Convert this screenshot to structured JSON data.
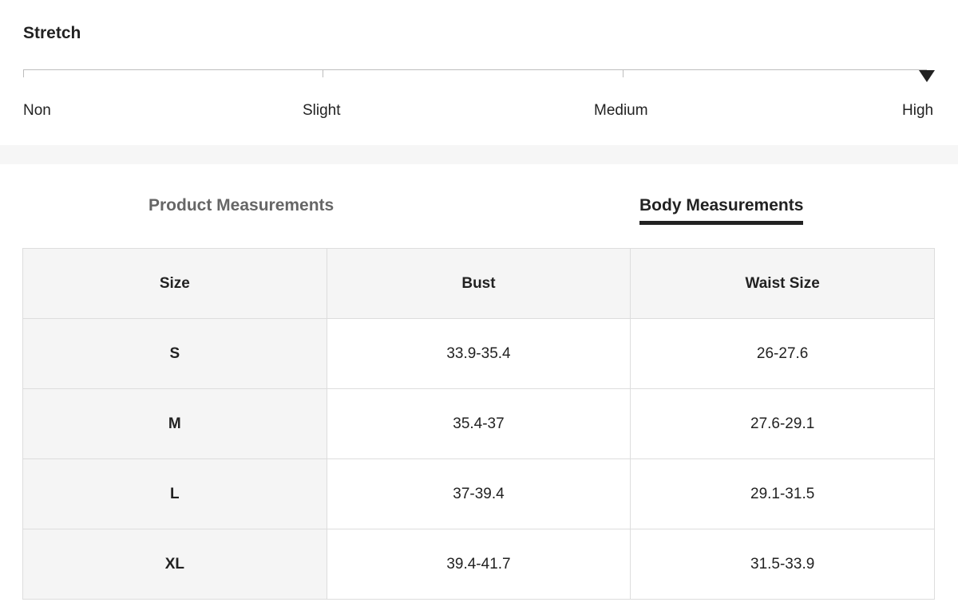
{
  "stretch": {
    "title": "Stretch",
    "levels": [
      "Non",
      "Slight",
      "Medium",
      "High"
    ],
    "selected_level": "High"
  },
  "tabs": {
    "product_label": "Product Measurements",
    "body_label": "Body Measurements",
    "active": "Body Measurements"
  },
  "table": {
    "headers": [
      "Size",
      "Bust",
      "Waist Size"
    ],
    "rows": [
      [
        "S",
        "33.9-35.4",
        "26-27.6"
      ],
      [
        "M",
        "35.4-37",
        "27.6-29.1"
      ],
      [
        "L",
        "37-39.4",
        "29.1-31.5"
      ],
      [
        "XL",
        "39.4-41.7",
        "31.5-33.9"
      ]
    ]
  },
  "colors": {
    "text": "#222222",
    "inactive_tab": "#666666",
    "header_bg": "#f5f5f5",
    "border": "#dddddd",
    "accent": "#222222"
  }
}
